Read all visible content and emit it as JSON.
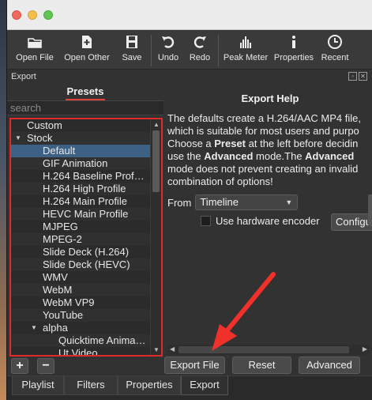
{
  "toolbar": {
    "items": [
      {
        "label": "Open File",
        "icon": "open-folder-icon"
      },
      {
        "label": "Open Other",
        "icon": "open-other-icon"
      },
      {
        "label": "Save",
        "icon": "save-icon"
      },
      {
        "label": "Undo",
        "icon": "undo-icon"
      },
      {
        "label": "Redo",
        "icon": "redo-icon"
      },
      {
        "label": "Peak Meter",
        "icon": "peak-meter-icon"
      },
      {
        "label": "Properties",
        "icon": "info-icon"
      },
      {
        "label": "Recent",
        "icon": "clock-icon"
      }
    ]
  },
  "panel": {
    "title": "Export"
  },
  "presets": {
    "tab_label": "Presets",
    "search_placeholder": "search",
    "tree": [
      {
        "label": "Custom",
        "level": 1,
        "arrow": ""
      },
      {
        "label": "Stock",
        "level": 1,
        "arrow": "▼"
      },
      {
        "label": "Default",
        "level": 2,
        "arrow": "",
        "selected": true
      },
      {
        "label": "GIF Animation",
        "level": 2,
        "arrow": ""
      },
      {
        "label": "H.264 Baseline Prof…",
        "level": 2,
        "arrow": ""
      },
      {
        "label": "H.264 High Profile",
        "level": 2,
        "arrow": ""
      },
      {
        "label": "H.264 Main Profile",
        "level": 2,
        "arrow": ""
      },
      {
        "label": "HEVC Main Profile",
        "level": 2,
        "arrow": ""
      },
      {
        "label": "MJPEG",
        "level": 2,
        "arrow": ""
      },
      {
        "label": "MPEG-2",
        "level": 2,
        "arrow": ""
      },
      {
        "label": "Slide Deck (H.264)",
        "level": 2,
        "arrow": ""
      },
      {
        "label": "Slide Deck (HEVC)",
        "level": 2,
        "arrow": ""
      },
      {
        "label": "WMV",
        "level": 2,
        "arrow": ""
      },
      {
        "label": "WebM",
        "level": 2,
        "arrow": ""
      },
      {
        "label": "WebM VP9",
        "level": 2,
        "arrow": ""
      },
      {
        "label": "YouTube",
        "level": 2,
        "arrow": ""
      },
      {
        "label": "alpha",
        "level": 2,
        "arrow": "▼"
      },
      {
        "label": "Quicktime Anima…",
        "level": 3,
        "arrow": ""
      },
      {
        "label": "Ut Video",
        "level": 3,
        "arrow": ""
      }
    ]
  },
  "help": {
    "title": "Export Help",
    "line1": "The defaults create a H.264/AAC MP4 file,",
    "line2": "which is suitable for most users and purpo",
    "line3_pre": "Choose a ",
    "line3_bold": "Preset",
    "line3_post": " at the left before decidin",
    "line4_pre": "use the ",
    "line4_bold1": "Advanced",
    "line4_mid": " mode.The ",
    "line4_bold2": "Advanced",
    "line5": "mode does not prevent creating an invalid",
    "line6": "combination of options!"
  },
  "from": {
    "label": "From",
    "value": "Timeline"
  },
  "hardware_encoder": {
    "label": "Use hardware encoder",
    "checked": false,
    "configure_label": "Configur"
  },
  "buttons": {
    "add": "+",
    "remove": "−",
    "export_file": "Export File",
    "reset": "Reset",
    "advanced": "Advanced"
  },
  "tabs": [
    "Playlist",
    "Filters",
    "Properties",
    "Export"
  ],
  "colors": {
    "accent_red": "#e02b2b",
    "selection": "#3d6185"
  }
}
